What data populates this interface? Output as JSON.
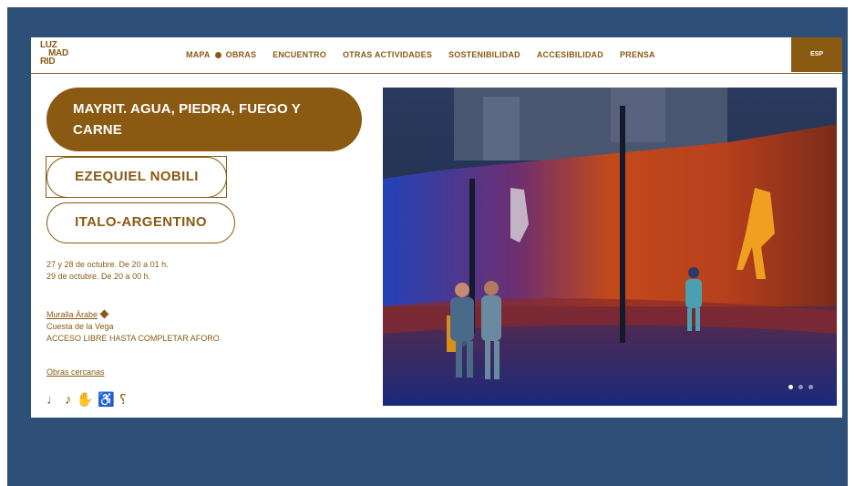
{
  "logo": {
    "line1": "LUZ",
    "line2": "MAD",
    "line3": "RID"
  },
  "nav": {
    "items": [
      {
        "label": "MAPA"
      },
      {
        "label": "OBRAS"
      },
      {
        "label": "ENCUENTRO"
      },
      {
        "label": "OTRAS ACTIVIDADES"
      },
      {
        "label": "SOSTENIBILIDAD"
      },
      {
        "label": "ACCESIBILIDAD"
      },
      {
        "label": "PRENSA"
      }
    ],
    "language": "ESP"
  },
  "work": {
    "title": "MAYRIT. AGUA, PIEDRA, FUEGO Y CARNE",
    "artist": "EZEQUIEL NOBILI",
    "nationality": "ITALO-ARGENTINO",
    "dates": [
      "27 y 28 de octubre. De 20 a 01 h.",
      "29 de octubre. De 20 a 00 h."
    ],
    "location": {
      "name": "Muralla Árabe",
      "street": "Cuesta de la Vega",
      "access": "ACCESO LIBRE HASTA COMPLETAR AFORO"
    },
    "nearby_link": "Obras cercanas",
    "accessibility_icons": [
      "hearing-loop-icon",
      "audio-description-icon",
      "sign-language-icon",
      "wheelchair-icon",
      "hearing-impaired-icon"
    ]
  },
  "carousel": {
    "slides": 3,
    "active": 1
  },
  "colors": {
    "brand": "#8a5a12",
    "frame": "#2d4f78",
    "background": "#ffffff"
  }
}
